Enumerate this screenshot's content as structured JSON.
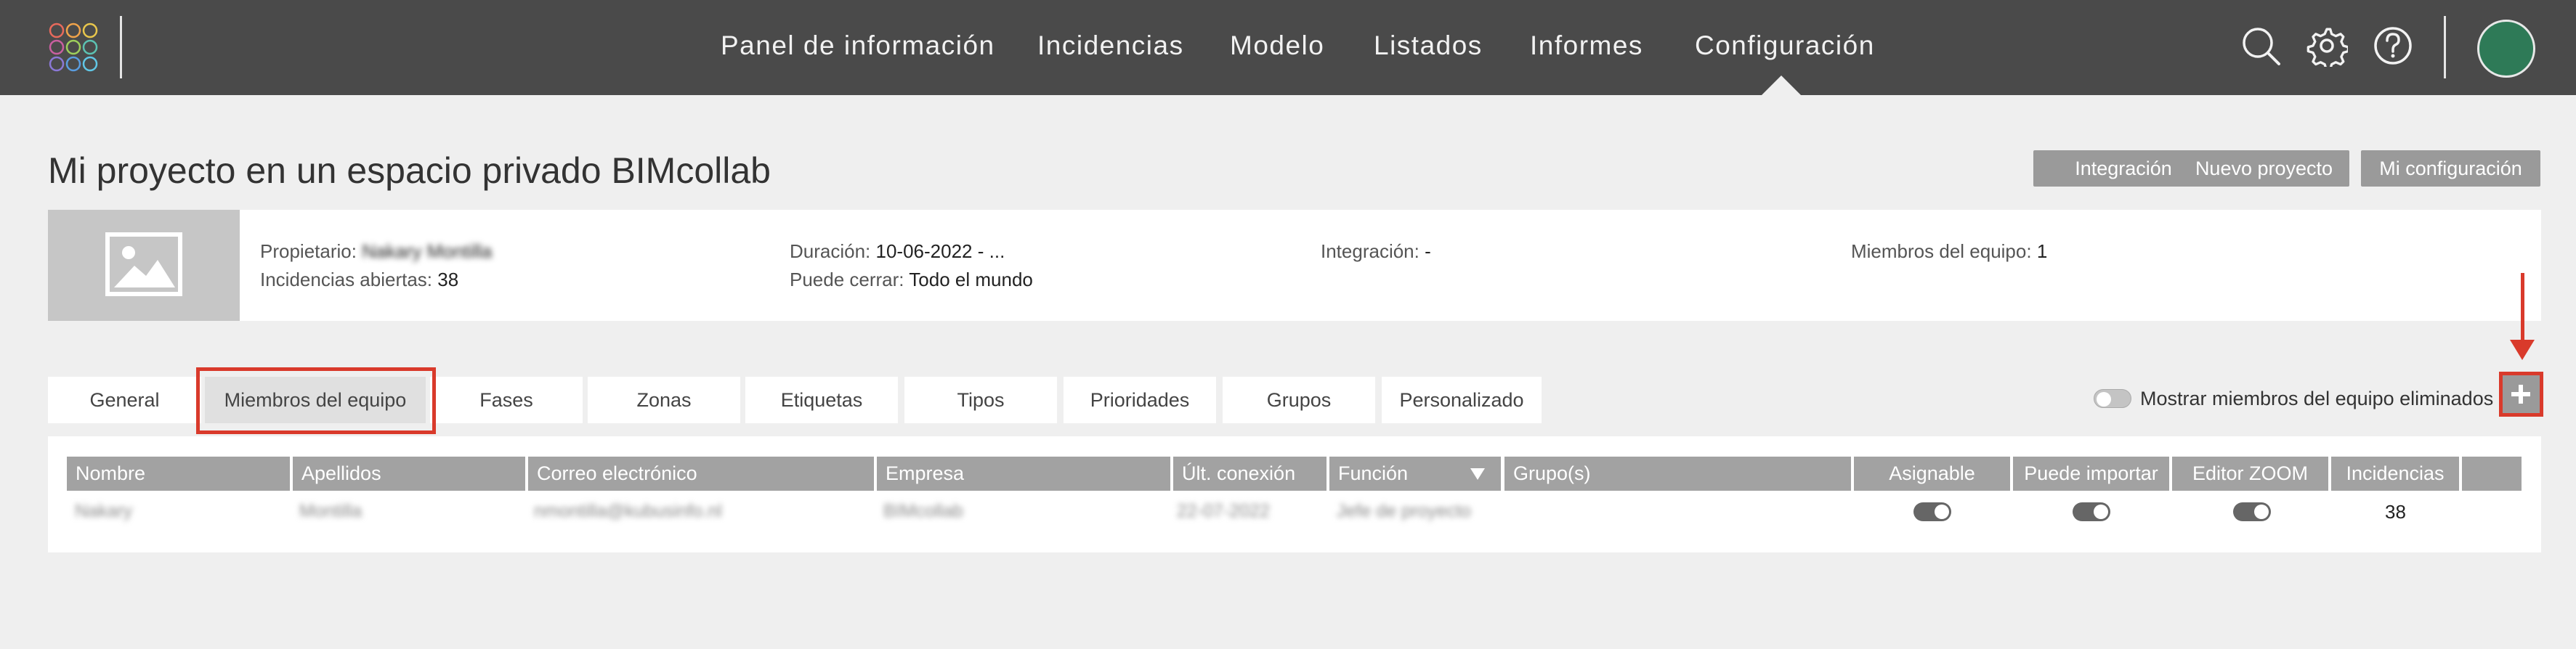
{
  "nav": {
    "items": [
      "Panel de información",
      "Incidencias",
      "Modelo",
      "Listados",
      "Informes",
      "Configuración"
    ],
    "active": "Configuración"
  },
  "icons": {
    "search": "search-icon",
    "settings": "gear-icon",
    "help": "help-icon",
    "logo": "app-logo"
  },
  "colors": {
    "topbar": "#4a4a4a",
    "avatar": "#2e7a57",
    "highlight": "#d93a2b",
    "button": "#9a9a9a"
  },
  "header": {
    "title": "Mi proyecto en un espacio privado BIMcollab",
    "buttons": {
      "integration": "Integración",
      "new_project": "Nuevo proyecto",
      "my_config": "Mi configuración"
    }
  },
  "project_info": {
    "owner_label": "Propietario:",
    "owner_value": "Nakary Montilla",
    "open_issues_label": "Incidencias abiertas:",
    "open_issues_value": "38",
    "duration_label": "Duración:",
    "duration_value": "10-06-2022 - ...",
    "can_close_label": "Puede cerrar:",
    "can_close_value": "Todo el mundo",
    "integration_label": "Integración:",
    "integration_value": "-",
    "team_members_label": "Miembros del equipo:",
    "team_members_value": "1"
  },
  "tabs": {
    "items": [
      "General",
      "Miembros del equipo",
      "Fases",
      "Zonas",
      "Etiquetas",
      "Tipos",
      "Prioridades",
      "Grupos",
      "Personalizado"
    ],
    "active": "Miembros del equipo"
  },
  "show_deleted": {
    "label": "Mostrar miembros del equipo eliminados",
    "enabled": false
  },
  "table": {
    "columns": [
      "Nombre",
      "Apellidos",
      "Correo electrónico",
      "Empresa",
      "Últ. conexión",
      "Función",
      "Grupo(s)",
      "Asignable",
      "Puede importar",
      "Editor ZOOM",
      "Incidencias"
    ],
    "rows": [
      {
        "nombre": "Nakary",
        "apellidos": "Montilla",
        "correo": "nmontilla@kubusinfo.nl",
        "empresa": "BIMcollab",
        "ult_conexion": "22-07-2022",
        "funcion": "Jefe de proyecto",
        "grupos": "",
        "asignable": true,
        "puede_importar": true,
        "editor_zoom": true,
        "incidencias": "38"
      }
    ]
  }
}
